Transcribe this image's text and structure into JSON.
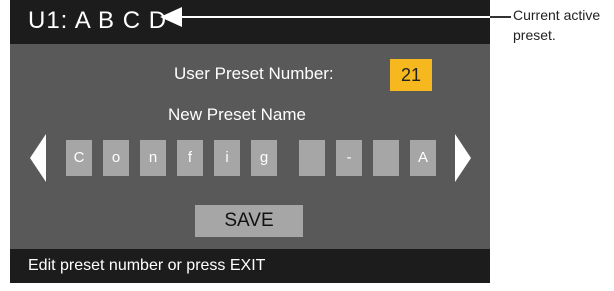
{
  "header": {
    "current_preset": "U1: A B C D"
  },
  "preset": {
    "number_label": "User Preset Number:",
    "number_value": "21",
    "number_color": "#f5b81f"
  },
  "name_editor": {
    "label": "New Preset Name",
    "characters": [
      "C",
      "o",
      "n",
      "f",
      "i",
      "g",
      "",
      "-",
      "",
      "A"
    ]
  },
  "save": {
    "label": "SAVE"
  },
  "status": {
    "text": "Edit preset number or press EXIT"
  },
  "callout": {
    "text": "Current active preset."
  },
  "icons": {
    "left": "left-arrow-icon",
    "right": "right-arrow-icon",
    "pointer": "pointer-arrow-icon"
  },
  "colors": {
    "screen_bg": "#595959",
    "bar_bg": "#1c1c1c",
    "cell_bg": "#a6a6a6"
  }
}
